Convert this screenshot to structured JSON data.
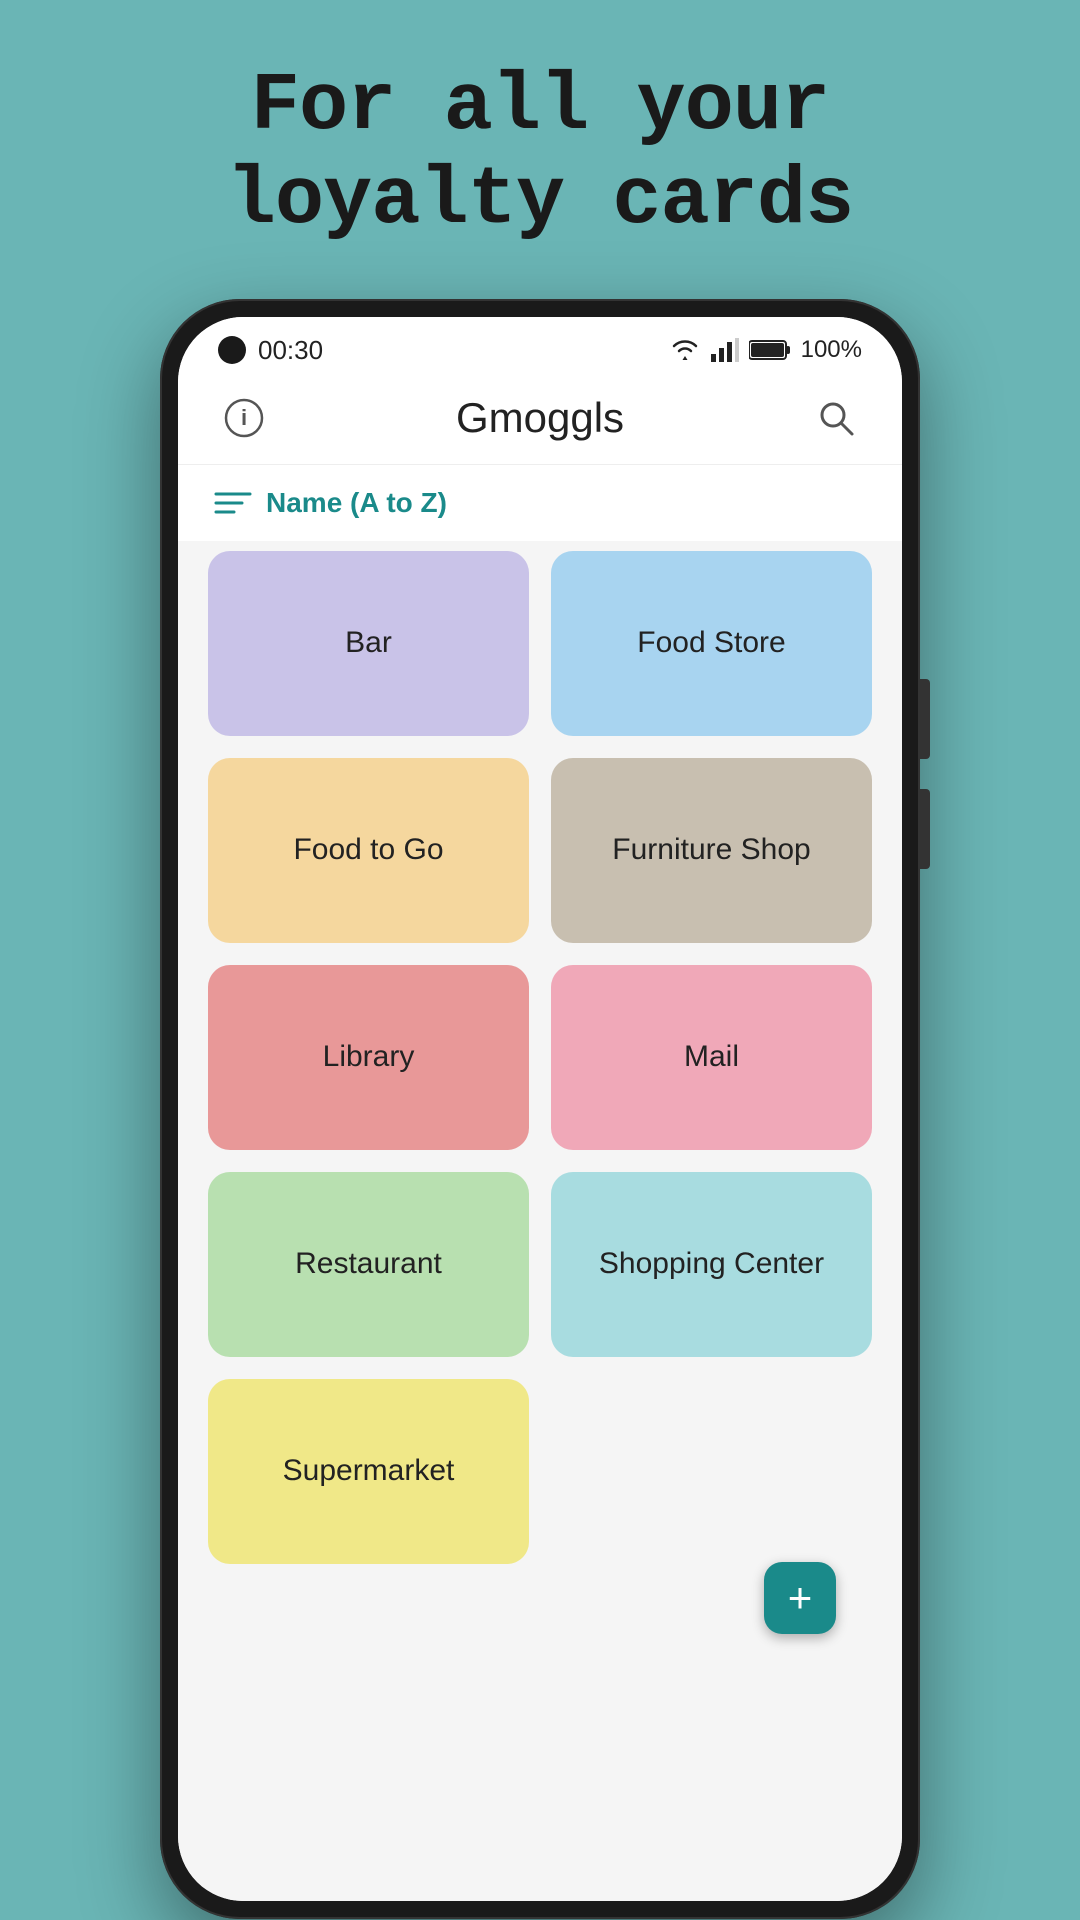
{
  "headline": {
    "line1": "For all your",
    "line2": "loyalty cards"
  },
  "status_bar": {
    "time": "00:30",
    "battery_pct": "100%"
  },
  "app_bar": {
    "title": "Gmoggls",
    "info_icon": "ℹ",
    "search_icon": "🔍"
  },
  "sort": {
    "label": "Name (A to Z)"
  },
  "grid_items": [
    {
      "id": "bar",
      "label": "Bar",
      "color_class": "color-purple"
    },
    {
      "id": "food-store",
      "label": "Food Store",
      "color_class": "color-blue"
    },
    {
      "id": "food-to-go",
      "label": "Food to Go",
      "color_class": "color-yellow"
    },
    {
      "id": "furniture-shop",
      "label": "Furniture Shop",
      "color_class": "color-tan"
    },
    {
      "id": "library",
      "label": "Library",
      "color_class": "color-pink-dark"
    },
    {
      "id": "mail",
      "label": "Mail",
      "color_class": "color-pink-light"
    },
    {
      "id": "restaurant",
      "label": "Restaurant",
      "color_class": "color-green"
    },
    {
      "id": "shopping-center",
      "label": "Shopping Center",
      "color_class": "color-teal-light"
    },
    {
      "id": "supermarket",
      "label": "Supermarket",
      "color_class": "color-yellow-light"
    }
  ],
  "fab": {
    "label": "+"
  }
}
